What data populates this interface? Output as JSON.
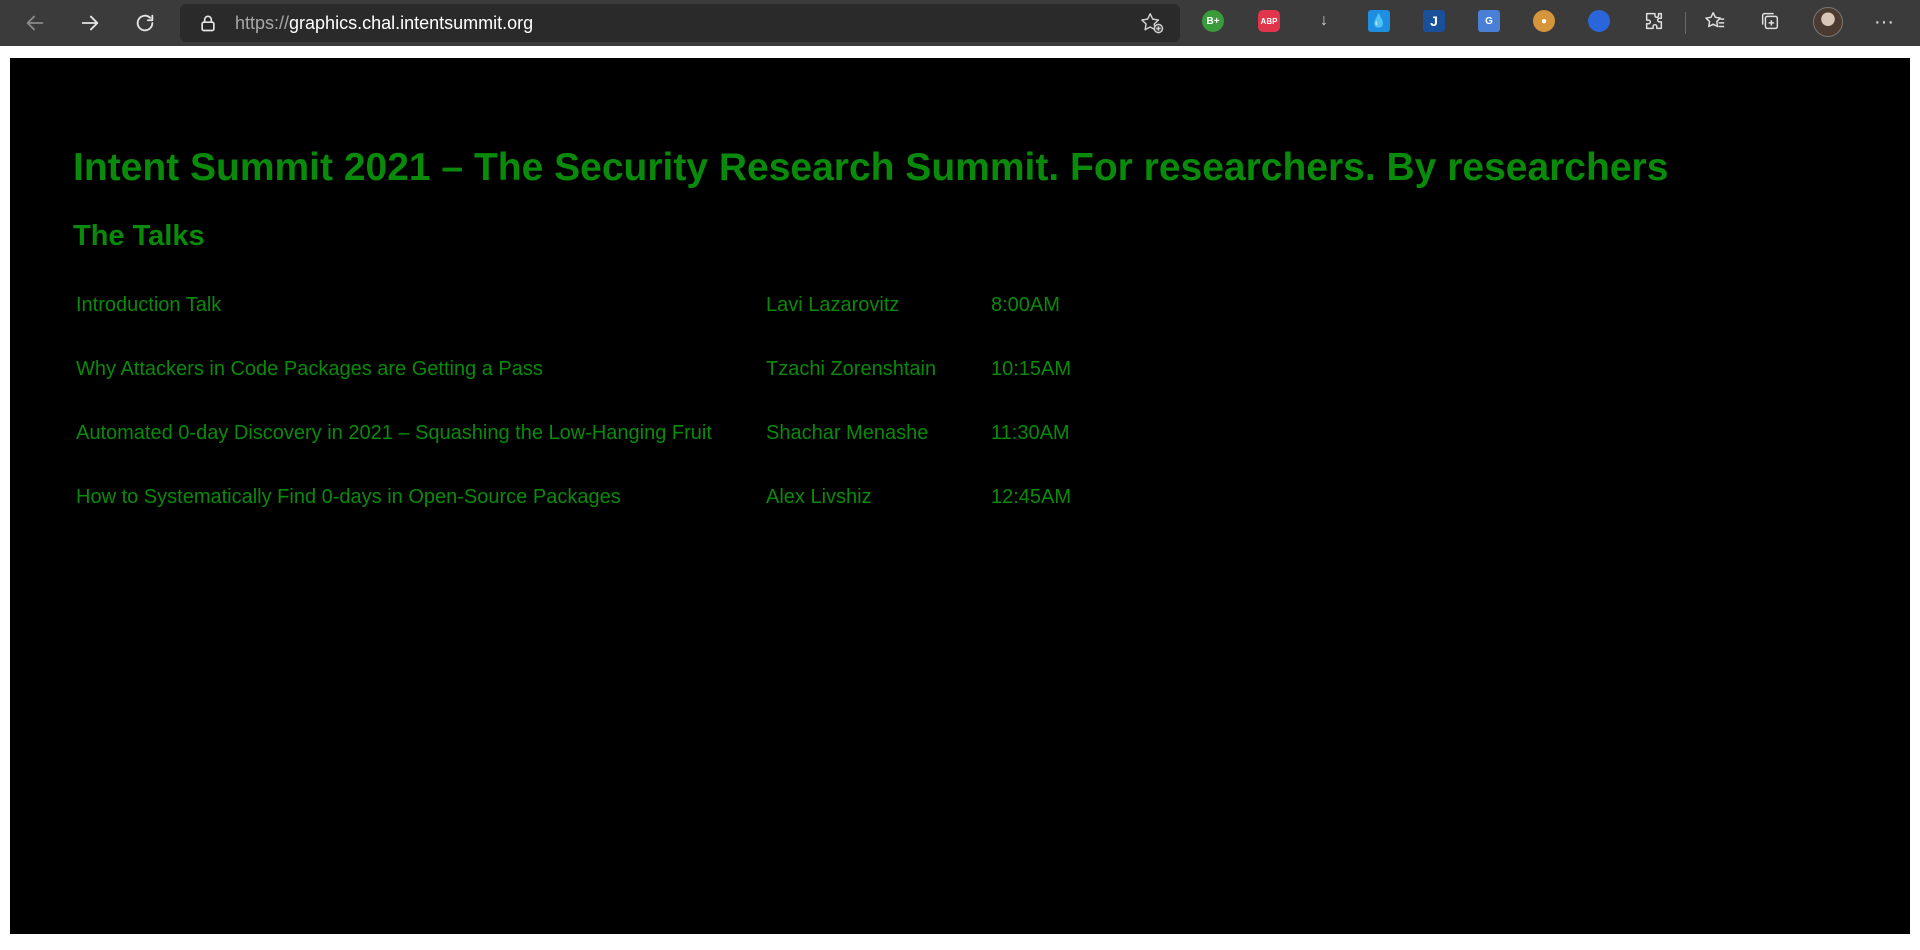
{
  "browser": {
    "url_scheme": "https://",
    "url_host": "graphics.chal.intentsummit.org",
    "extensions": {
      "bplus": "B+",
      "abp": "ABP",
      "gt": "G"
    }
  },
  "page": {
    "title": "Intent Summit 2021 – The Security Research Summit. For researchers. By researchers",
    "section_title": "The Talks",
    "talks": [
      {
        "title": "Introduction Talk",
        "speaker": "Lavi Lazarovitz",
        "time": "8:00AM"
      },
      {
        "title": "Why Attackers in Code Packages are Getting a Pass",
        "speaker": "Tzachi Zorenshtain",
        "time": "10:15AM"
      },
      {
        "title": "Automated 0-day Discovery in 2021 – Squashing the Low-Hanging Fruit",
        "speaker": "Shachar Menashe",
        "time": "11:30AM"
      },
      {
        "title": "How to Systematically Find 0-days in Open-Source Packages",
        "speaker": "Alex Livshiz",
        "time": "12:45AM"
      }
    ]
  },
  "colors": {
    "page_background": "#000000",
    "text_green": "#0a8a0a",
    "chrome_toolbar": "#3b3b3b"
  }
}
